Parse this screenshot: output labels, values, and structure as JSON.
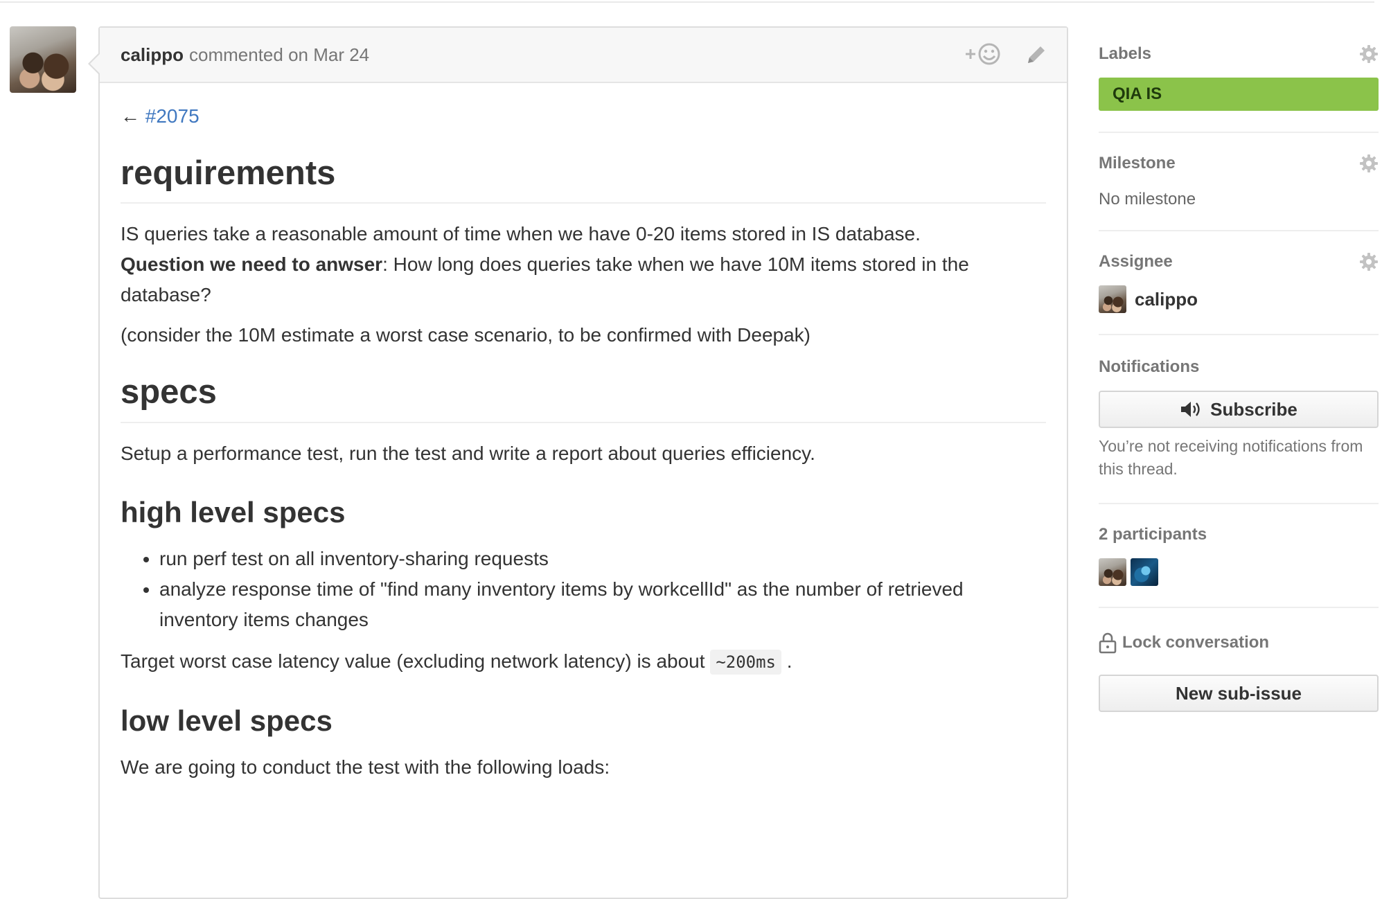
{
  "comment": {
    "author": "calippo",
    "meta": "commented on Mar 24",
    "back_arrow": "←",
    "back_ref": "#2075",
    "sections": {
      "requirements_heading": "requirements",
      "requirements_p1": "IS queries take a reasonable amount of time when we have 0-20 items stored in IS database.",
      "requirements_q_bold": "Question we need to anwser",
      "requirements_q_rest": ": How long does queries take when we have 10M items stored in the database?",
      "requirements_p2": "(consider the 10M estimate a worst case scenario, to be confirmed with Deepak)",
      "specs_heading": "specs",
      "specs_p": "Setup a performance test, run the test and write a report about queries efficiency.",
      "high_level_heading": "high level specs",
      "high_level_items": [
        "run perf test on all inventory-sharing requests",
        "analyze response time of \"find many inventory items by workcellId\" as the number of retrieved inventory items changes"
      ],
      "target_text": "Target worst case latency value (excluding network latency) is about",
      "target_code": "~200ms",
      "target_end": ".",
      "low_level_heading": "low level specs",
      "low_level_p": "We are going to conduct the test with the following loads:"
    }
  },
  "sidebar": {
    "labels_title": "Labels",
    "label_name": "QIA IS",
    "label_color": "#8bc34a",
    "milestone_title": "Milestone",
    "milestone_value": "No milestone",
    "assignee_title": "Assignee",
    "assignee_name": "calippo",
    "notifications_title": "Notifications",
    "subscribe_label": "Subscribe",
    "notifications_text": "You’re not receiving notifications from this thread.",
    "participants_title": "2 participants",
    "lock_label": "Lock conversation",
    "new_subissue_label": "New sub-issue"
  },
  "icons": [
    "add-reaction-icon",
    "pencil-icon",
    "gear-icon",
    "speaker-icon",
    "lock-icon"
  ]
}
